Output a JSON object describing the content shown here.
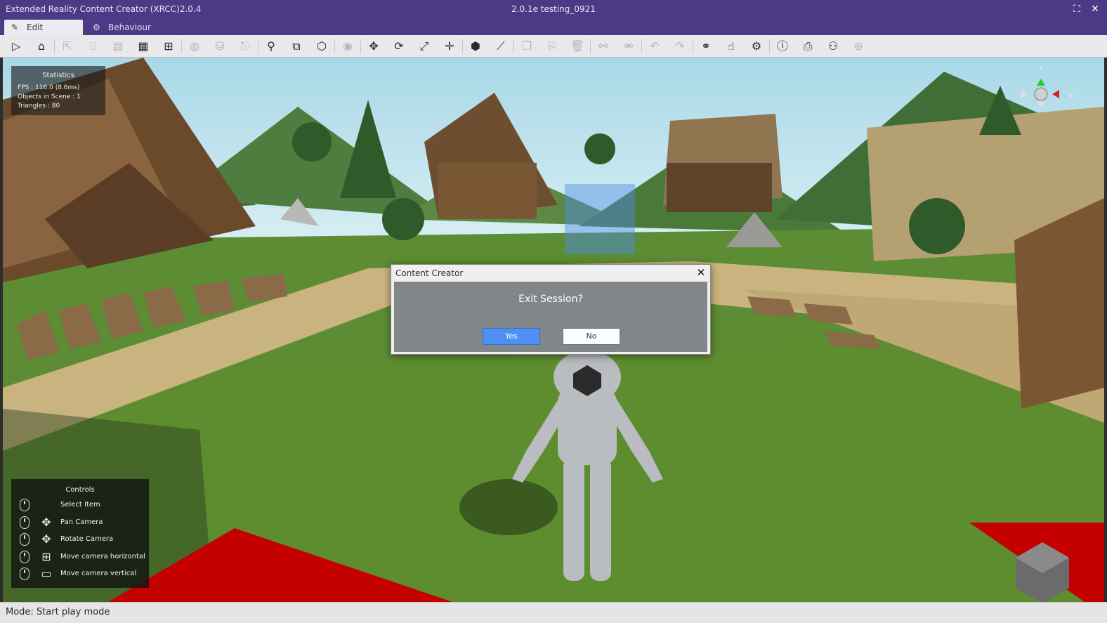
{
  "window": {
    "app_title": "Extended Reality Content Creator (XRCC)2.0.4",
    "document_title": "2.0.1e testing_0921",
    "maximize_icon": "⛶",
    "close_icon": "✕"
  },
  "tabs": [
    {
      "label": "Edit",
      "icon": "✎"
    },
    {
      "label": "Behaviour",
      "icon": "⚙"
    }
  ],
  "toolbar": {
    "tools": [
      {
        "name": "play-icon",
        "glyph": "▷",
        "enabled": true
      },
      {
        "name": "home-icon",
        "glyph": "⌂",
        "enabled": true
      },
      {
        "name": "export-icon",
        "glyph": "⇱",
        "enabled": false
      },
      {
        "name": "open-icon",
        "glyph": "⌸",
        "enabled": false
      },
      {
        "name": "save-icon",
        "glyph": "▤",
        "enabled": false
      },
      {
        "name": "save-as-icon",
        "glyph": "▦",
        "enabled": true
      },
      {
        "name": "import-icon",
        "glyph": "⊞",
        "enabled": true
      },
      {
        "name": "asset-library-icon",
        "glyph": "◍",
        "enabled": false
      },
      {
        "name": "publish-icon",
        "glyph": "⛁",
        "enabled": false
      },
      {
        "name": "share-icon",
        "glyph": "⎋",
        "enabled": false
      },
      {
        "name": "scene-settings-icon",
        "glyph": "⚲",
        "enabled": true
      },
      {
        "name": "object-list-icon",
        "glyph": "⧉",
        "enabled": true
      },
      {
        "name": "add-object-icon",
        "glyph": "⬡",
        "enabled": true
      },
      {
        "name": "visibility-icon",
        "glyph": "◉",
        "enabled": false
      },
      {
        "name": "move-icon",
        "glyph": "✥",
        "enabled": true
      },
      {
        "name": "rotate-icon",
        "glyph": "⟳",
        "enabled": true
      },
      {
        "name": "scale-icon",
        "glyph": "⤢",
        "enabled": true
      },
      {
        "name": "pivot-icon",
        "glyph": "✛",
        "enabled": true
      },
      {
        "name": "bounds-icon",
        "glyph": "⬢",
        "enabled": true
      },
      {
        "name": "measure-icon",
        "glyph": "⟋",
        "enabled": true
      },
      {
        "name": "copy-icon",
        "glyph": "❐",
        "enabled": false
      },
      {
        "name": "paste-icon",
        "glyph": "⎘",
        "enabled": false
      },
      {
        "name": "delete-icon",
        "glyph": "🗑",
        "enabled": false
      },
      {
        "name": "link-icon",
        "glyph": "⚯",
        "enabled": false
      },
      {
        "name": "unlink-icon",
        "glyph": "⚮",
        "enabled": false
      },
      {
        "name": "undo-icon",
        "glyph": "↶",
        "enabled": false
      },
      {
        "name": "redo-icon",
        "glyph": "↷",
        "enabled": false
      },
      {
        "name": "connections-icon",
        "glyph": "⚭",
        "enabled": true
      },
      {
        "name": "help-cursor-icon",
        "glyph": "☝",
        "enabled": true
      },
      {
        "name": "settings-icon",
        "glyph": "⚙",
        "enabled": true
      },
      {
        "name": "info-icon",
        "glyph": "ⓘ",
        "enabled": true
      },
      {
        "name": "report-icon",
        "glyph": "⎙",
        "enabled": true
      },
      {
        "name": "users-icon",
        "glyph": "⚇",
        "enabled": true
      },
      {
        "name": "sync-icon",
        "glyph": "⊛",
        "enabled": false
      }
    ]
  },
  "statistics": {
    "title": "Statistics",
    "fps": "FPS : 116.0 (8.6ms)",
    "objects": "Objects in Scene : 1",
    "triangles": "Triangles : 80"
  },
  "gizmo": {
    "y_label": "Y",
    "x_label": "X"
  },
  "controls": {
    "title": "Controls",
    "items": [
      {
        "label": "Select Item",
        "glyph": ""
      },
      {
        "label": "Pan Camera",
        "glyph": "✥"
      },
      {
        "label": "Rotate Camera",
        "glyph": "✥"
      },
      {
        "label": "Move camera horizontal",
        "glyph": "⊞"
      },
      {
        "label": "Move camera vertical",
        "glyph": "▭"
      }
    ]
  },
  "dialog": {
    "title": "Content Creator",
    "message": "Exit Session?",
    "yes_label": "Yes",
    "no_label": "No",
    "close_icon": "✕"
  },
  "status": {
    "text": "Mode: Start play mode"
  },
  "colors": {
    "title_bar": "#4b3b86",
    "yes_button": "#4d8ff2",
    "accent_red": "#c40000"
  }
}
